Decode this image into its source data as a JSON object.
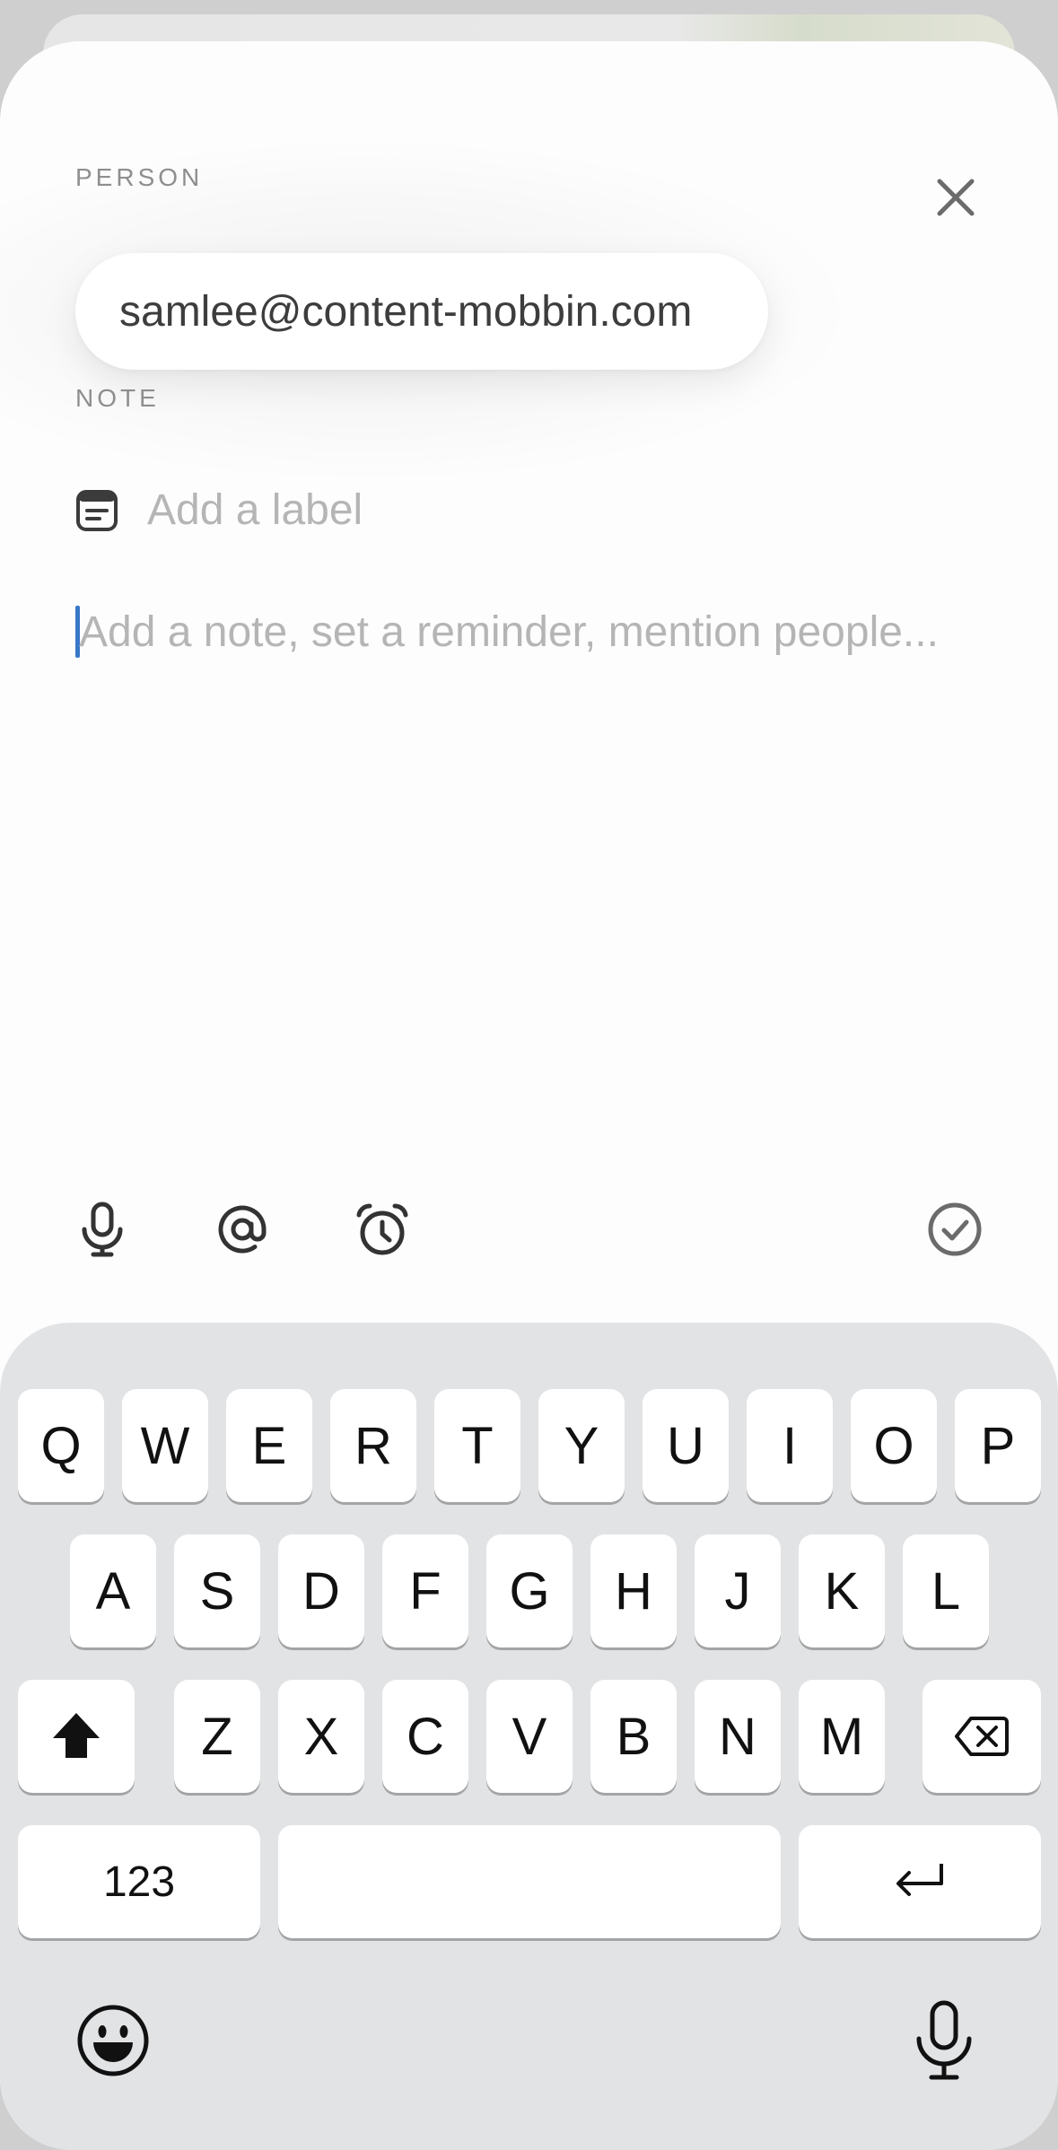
{
  "sheet": {
    "person_label": "PERSON",
    "person_email": "samlee@content-mobbin.com",
    "note_label": "NOTE",
    "label_placeholder": "Add a label",
    "note_placeholder": "Add a note, set a reminder, mention people..."
  },
  "toolbar": {
    "icons": [
      "microphone-icon",
      "mention-icon",
      "alarm-icon",
      "check-circle-icon"
    ]
  },
  "keyboard": {
    "row1": [
      "Q",
      "W",
      "E",
      "R",
      "T",
      "Y",
      "U",
      "I",
      "O",
      "P"
    ],
    "row2": [
      "A",
      "S",
      "D",
      "F",
      "G",
      "H",
      "J",
      "K",
      "L"
    ],
    "row3": [
      "Z",
      "X",
      "C",
      "V",
      "B",
      "N",
      "M"
    ],
    "numbers_label": "123",
    "space_label": "",
    "icons": [
      "shift-icon",
      "backspace-icon",
      "return-icon",
      "emoji-icon",
      "dictation-icon"
    ]
  },
  "colors": {
    "caret": "#3877c8",
    "keyboard_bg": "#e2e3e5",
    "icon": "#333333"
  }
}
